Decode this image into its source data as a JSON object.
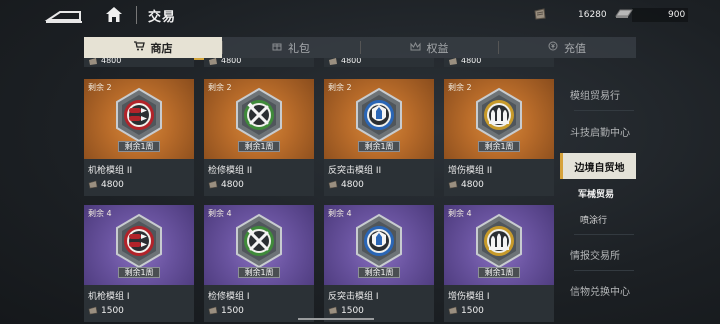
{
  "header": {
    "title": "交易",
    "currency_1": "16280",
    "currency_2": "900"
  },
  "tabs": [
    {
      "label": "商店",
      "icon": "cart-icon",
      "active": true
    },
    {
      "label": "礼包",
      "icon": "gift-icon",
      "active": false
    },
    {
      "label": "权益",
      "icon": "crown-icon",
      "active": false
    },
    {
      "label": "充值",
      "icon": "coin-icon",
      "active": false
    }
  ],
  "peek_row": [
    "4800",
    "4800",
    "4800",
    "4800"
  ],
  "items": [
    {
      "stock": "剩余 2",
      "badge": "剩余1周",
      "name": "机枪模组 II",
      "price": "4800",
      "tier": "orange",
      "icon": "bullet-icon"
    },
    {
      "stock": "剩余 2",
      "badge": "剩余1周",
      "name": "检修模组 II",
      "price": "4800",
      "tier": "orange",
      "icon": "wrench-hammer-icon"
    },
    {
      "stock": "剩余 2",
      "badge": "剩余1周",
      "name": "反突击模组 II",
      "price": "4800",
      "tier": "orange",
      "icon": "shield-shell-icon"
    },
    {
      "stock": "剩余 2",
      "badge": "剩余1周",
      "name": "增伤模组 II",
      "price": "4800",
      "tier": "orange",
      "icon": "ammo-stack-icon"
    },
    {
      "stock": "剩余 4",
      "badge": "剩余1周",
      "name": "机枪模组 I",
      "price": "1500",
      "tier": "purple",
      "icon": "bullet-icon"
    },
    {
      "stock": "剩余 4",
      "badge": "剩余1周",
      "name": "检修模组 I",
      "price": "1500",
      "tier": "purple",
      "icon": "wrench-hammer-icon"
    },
    {
      "stock": "剩余 4",
      "badge": "剩余1周",
      "name": "反突击模组 I",
      "price": "1500",
      "tier": "purple",
      "icon": "shield-shell-icon"
    },
    {
      "stock": "剩余 4",
      "badge": "剩余1周",
      "name": "增伤模组 I",
      "price": "1500",
      "tier": "purple",
      "icon": "ammo-stack-icon"
    }
  ],
  "sidebar": {
    "items": [
      "模组贸易行",
      "斗技启勤中心"
    ],
    "active": "边境自贸地",
    "sub_items": [
      "军械贸易",
      "喷涂行"
    ],
    "items_after": [
      "情报交易所",
      "信物兑换中心"
    ]
  },
  "colors": {
    "orange_tier": "#b96c2a",
    "purple_tier": "#6a54a0",
    "accent_gold": "#d6a23a"
  }
}
